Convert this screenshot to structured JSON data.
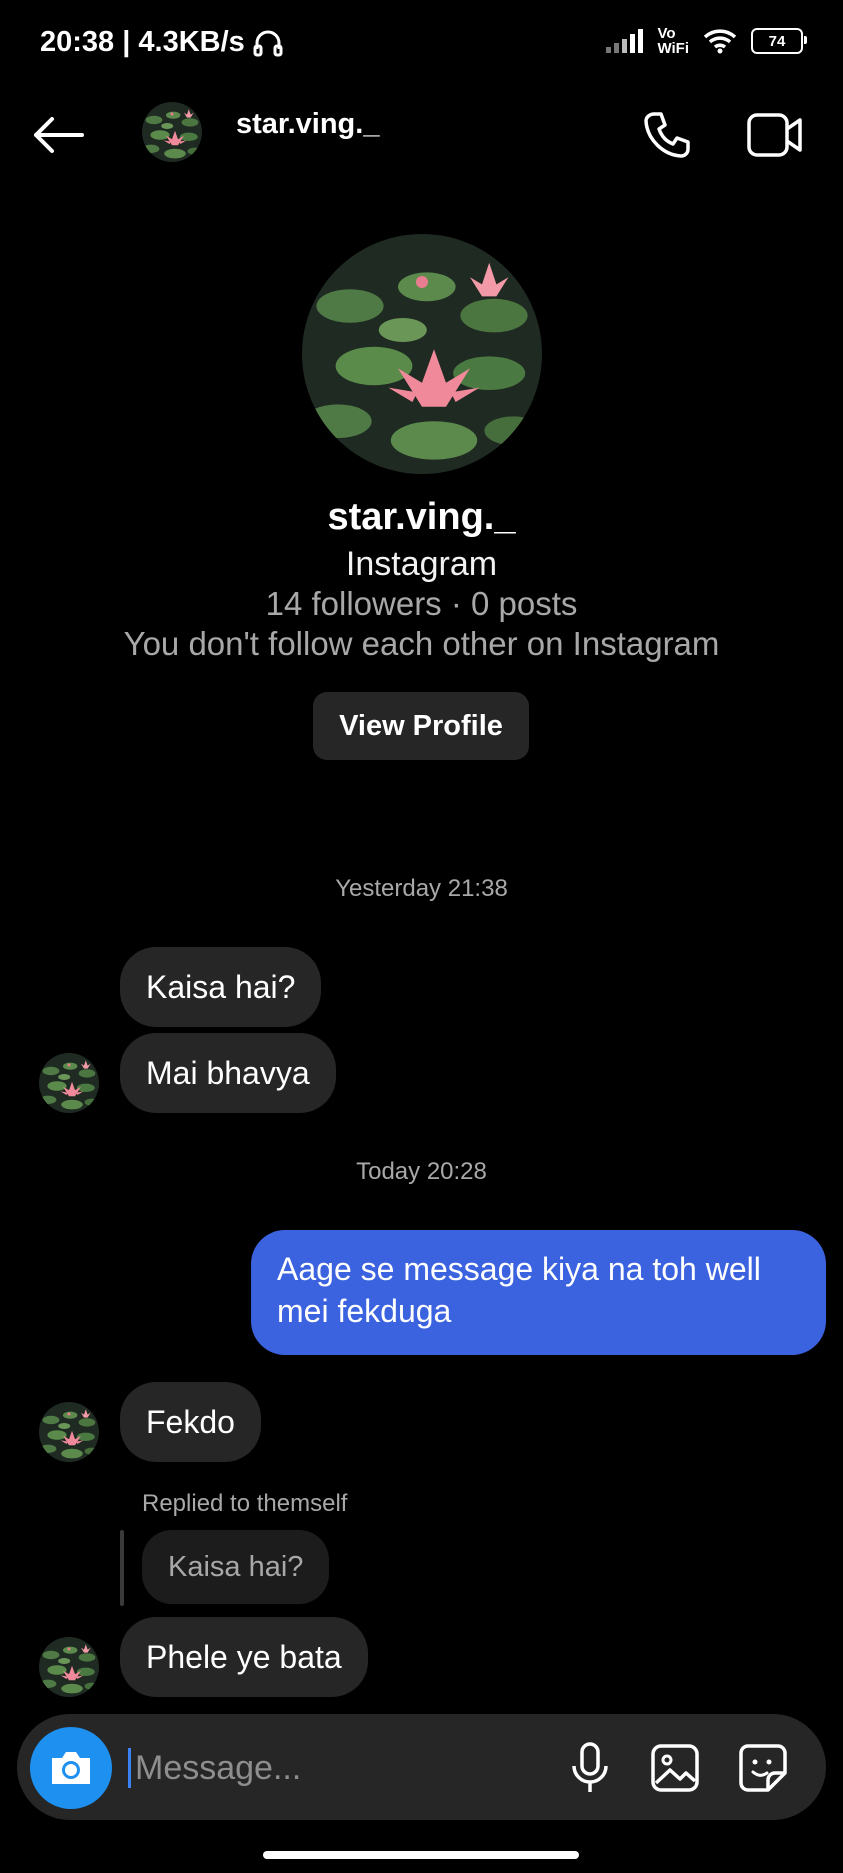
{
  "status_bar": {
    "time_speed": "20:38 | 4.3KB/s",
    "vowifi_top": "Vo",
    "vowifi_bottom": "WiFi",
    "battery": "74"
  },
  "header": {
    "username": "star.ving._"
  },
  "profile": {
    "username": "star.ving._",
    "platform": "Instagram",
    "stats": "14 followers · 0 posts",
    "follow_status": "You don't follow each other on Instagram",
    "view_profile_label": "View Profile"
  },
  "messages": {
    "ts1": "Yesterday 21:38",
    "in1": "Kaisa hai?",
    "in2": "Mai bhavya",
    "ts2": "Today 20:28",
    "out1_line1": "Aage se message kiya na toh well",
    "out1_line2": "mei fekduga",
    "in3": "Fekdo",
    "reply_label": "Replied to themself",
    "reply_quote": "Kaisa hai?",
    "in4": "Phele ye bata"
  },
  "composer": {
    "placeholder": "Message..."
  },
  "colors": {
    "background": "#000000",
    "incoming_bubble": "#262626",
    "outgoing_bubble": "#3b63e0",
    "camera_button": "#1e90f0"
  }
}
